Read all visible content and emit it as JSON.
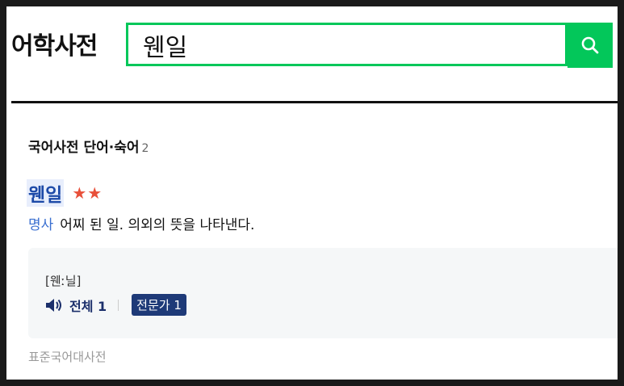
{
  "app": {
    "title": "어학사전"
  },
  "search": {
    "value": "웬일",
    "button_icon": "search-icon",
    "accent": "#03c75a"
  },
  "section": {
    "title": "국어사전 단어·숙어",
    "count": "2"
  },
  "entry": {
    "word": "웬일",
    "stars": "★★",
    "part_of_speech": "명사",
    "definition": "어찌 된 일. 의외의 뜻을 나타낸다.",
    "pronunciation": "[웬ː닐]",
    "audio_label": "전체 1",
    "expert_label": "전문가 1",
    "source": "표준국어대사전"
  },
  "colors": {
    "word": "#1d4aa8",
    "star": "#e8503a",
    "badge": "#1e3a78"
  }
}
